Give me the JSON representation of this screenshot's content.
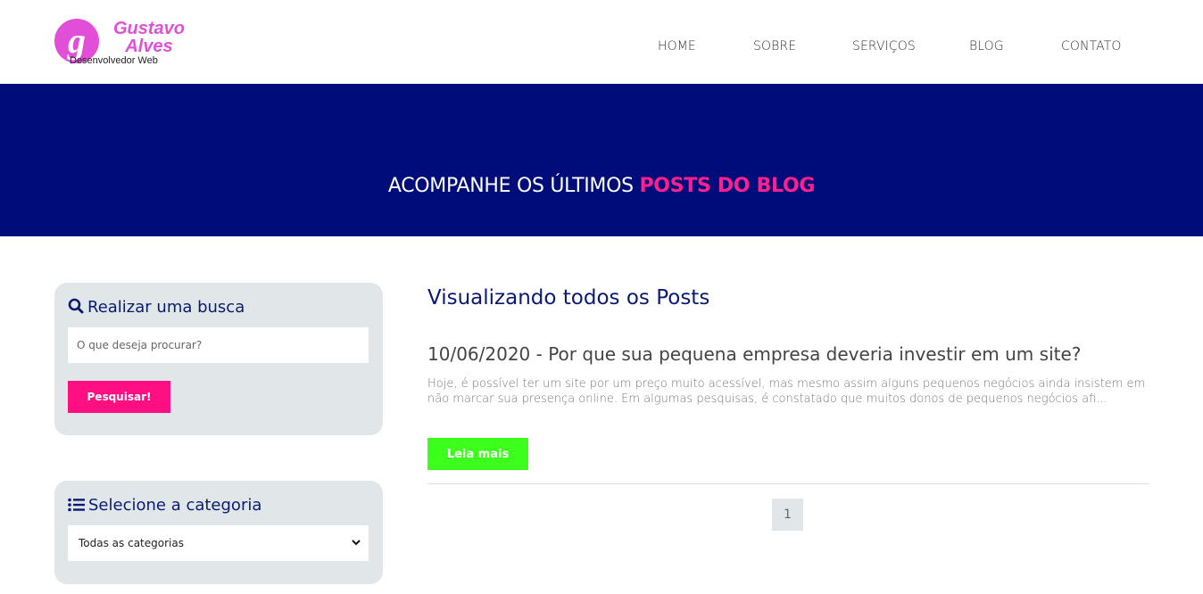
{
  "brand": {
    "name_line1": "Gustavo",
    "name_line2": "Alves",
    "subtitle": "Desenvolvedor Web",
    "logo_letter": "g",
    "color": "#e14fd8"
  },
  "nav": {
    "items": [
      {
        "label": "HOME"
      },
      {
        "label": "SOBRE"
      },
      {
        "label": "SERVIÇOS"
      },
      {
        "label": "BLOG"
      },
      {
        "label": "CONTATO"
      }
    ]
  },
  "hero": {
    "title_prefix": "ACOMPANHE OS ÚLTIMOS ",
    "title_highlight": "POSTS DO BLOG",
    "background": "#000c7a",
    "highlight_color": "#ff1f8e"
  },
  "sidebar": {
    "search": {
      "title": "Realizar uma busca",
      "icon": "search-icon",
      "placeholder": "O que deseja procurar?",
      "value": "",
      "button_label": "Pesquisar!",
      "button_color": "#ff0f82"
    },
    "category": {
      "title": "Selecione a categoria",
      "icon": "list-icon",
      "selected": "Todas as categorias"
    }
  },
  "main": {
    "title": "Visualizando todos os Posts",
    "posts": [
      {
        "title": "10/06/2020 - Por que sua pequena empresa deveria investir em um site?",
        "excerpt": "Hoje, é possível ter um site por um preço muito acessível, mas mesmo assim alguns pequenos negócios ainda insistem em não marcar sua presença online. Em algumas pesquisas, é constatado que muitos donos de pequenos negócios afi...",
        "button_label": "Leia mais",
        "button_color": "#3cff1c"
      }
    ],
    "pagination": {
      "current": "1"
    }
  }
}
